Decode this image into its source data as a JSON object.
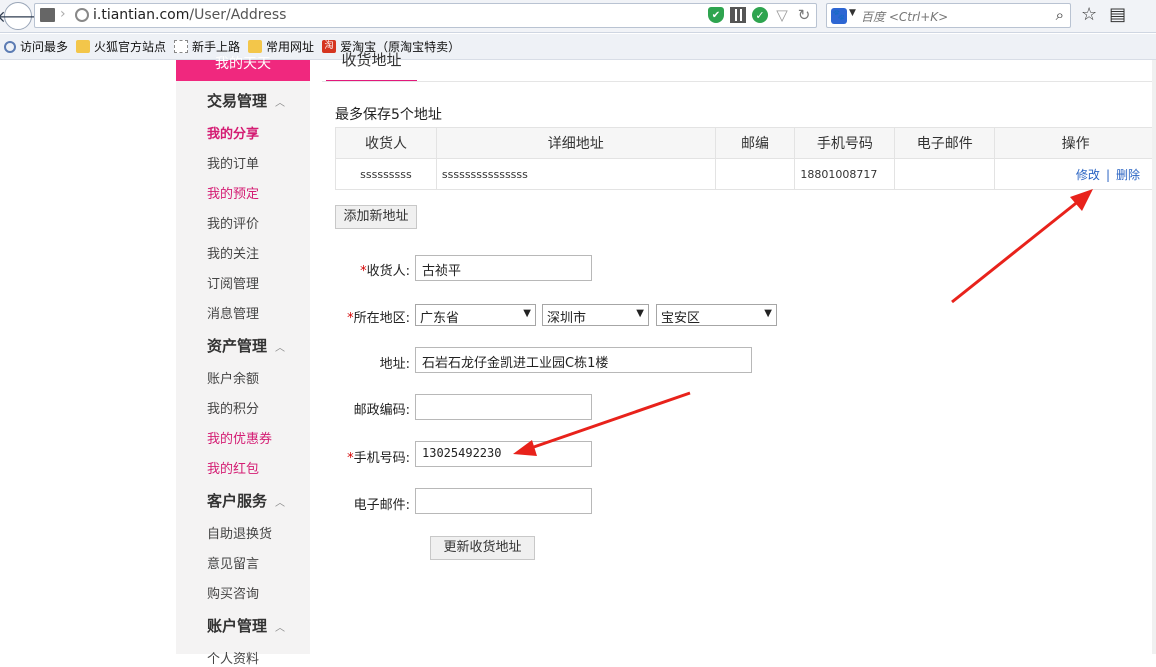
{
  "browser": {
    "url_host": "i.tiantian.com",
    "url_path": "/User/Address",
    "search_placeholder": "百度 <Ctrl+K>",
    "bookmarks": [
      "访问最多",
      "火狐官方站点",
      "新手上路",
      "常用网址",
      "爱淘宝（原淘宝特卖）"
    ],
    "taobao_glyph": "淘"
  },
  "sidebar": {
    "top_item": "我的天天",
    "sections": [
      {
        "title": "交易管理",
        "items": [
          "我的分享",
          "我的订单",
          "我的预定",
          "我的评价",
          "我的关注",
          "订阅管理",
          "消息管理"
        ]
      },
      {
        "title": "资产管理",
        "items": [
          "账户余额",
          "我的积分",
          "我的优惠券",
          "我的红包"
        ]
      },
      {
        "title": "客户服务",
        "items": [
          "自助退换货",
          "意见留言",
          "购买咨询"
        ]
      },
      {
        "title": "账户管理",
        "items": [
          "个人资料"
        ]
      }
    ]
  },
  "main": {
    "tab_title": "收货地址",
    "max_note": "最多保存5个地址",
    "table": {
      "headers": [
        "收货人",
        "详细地址",
        "邮编",
        "手机号码",
        "电子邮件",
        "操作"
      ],
      "rows": [
        {
          "name": "sssssssss",
          "address": "sssssssssssssss",
          "zip": "",
          "phone": "18801008717",
          "email": "",
          "edit": "修改",
          "sep": "|",
          "delete": "删除"
        }
      ]
    },
    "add_button": "添加新地址",
    "form": {
      "receiver_label": "收货人:",
      "receiver_value": "古祯平",
      "region_label": "所在地区:",
      "province": "广东省",
      "city": "深圳市",
      "district": "宝安区",
      "address_label": "地址:",
      "address_value": "石岩石龙仔金凯进工业园C栋1楼",
      "zip_label": "邮政编码:",
      "zip_value": "",
      "phone_label": "手机号码:",
      "phone_value": "13025492230",
      "email_label": "电子邮件:",
      "email_value": "",
      "required_mark": "*",
      "submit_button": "更新收货地址"
    }
  },
  "colors": {
    "accent": "#f0287e",
    "link": "#2a64c3",
    "annotation_arrow": "#e8221b"
  }
}
